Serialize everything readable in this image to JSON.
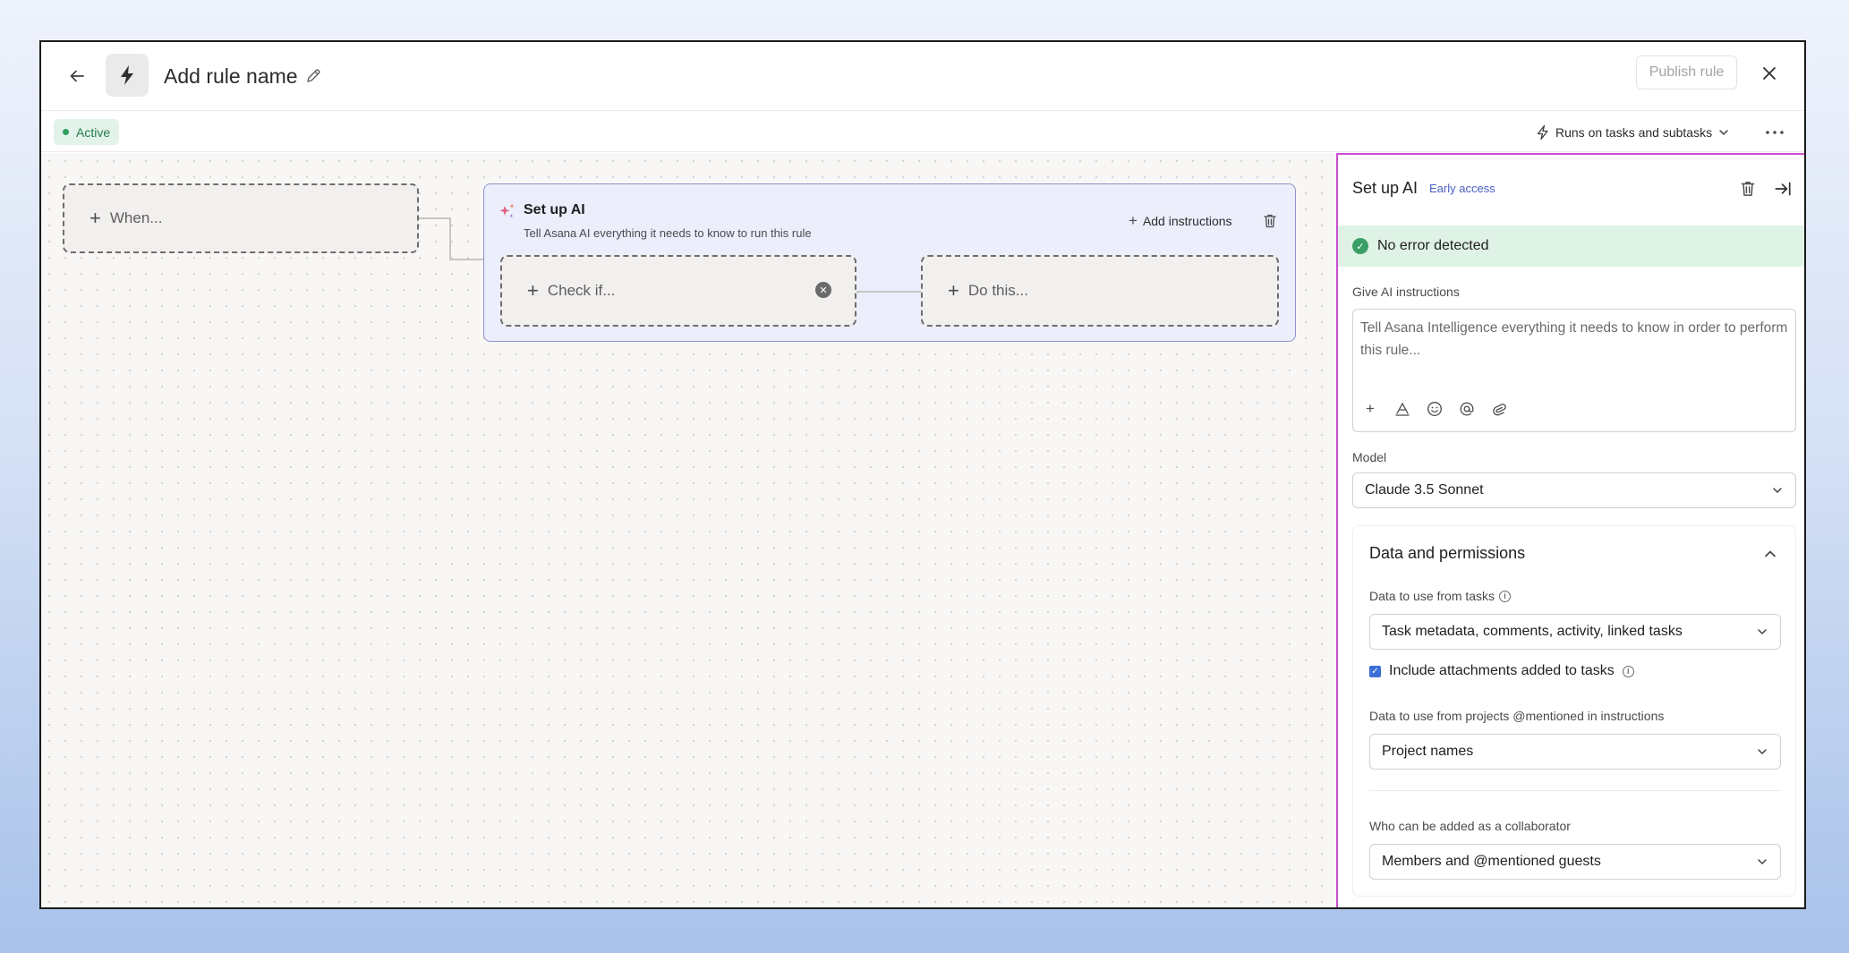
{
  "header": {
    "back_icon": "arrow-left-icon",
    "rule_icon": "lightning-bolt-icon",
    "title": "Add rule name",
    "edit_icon": "pencil-icon",
    "publish_label": "Publish rule",
    "close_icon": "close-icon"
  },
  "subbar": {
    "status": "Active",
    "runs_on": "Runs on tasks and subtasks",
    "more_icon": "ellipsis-icon"
  },
  "canvas": {
    "when_label": "When...",
    "ai_card": {
      "title": "Set up AI",
      "subtitle": "Tell Asana AI everything it needs to know to run this rule",
      "add_instructions": "Add instructions",
      "check_label": "Check if...",
      "do_label": "Do this..."
    }
  },
  "panel": {
    "title": "Set up AI",
    "badge": "Early access",
    "status": "No error detected",
    "instructions_label": "Give AI instructions",
    "instructions_placeholder": "Tell Asana Intelligence everything it needs to know in order to perform this rule...",
    "model_label": "Model",
    "model_value": "Claude 3.5 Sonnet",
    "permissions": {
      "title": "Data and permissions",
      "task_data_label": "Data to use from tasks",
      "task_data_value": "Task metadata, comments, activity, linked tasks",
      "include_attachments_label": "Include attachments added to tasks",
      "include_attachments_checked": true,
      "project_data_label": "Data to use from projects @mentioned in instructions",
      "project_data_value": "Project names",
      "collaborator_label": "Who can be added as a collaborator",
      "collaborator_value": "Members and @mentioned guests"
    }
  },
  "colors": {
    "accent_purple_border": "#c84fd0",
    "active_green": "#2f9e60",
    "ai_card_bg": "#eceefb",
    "success_bg": "#dff2e6",
    "early_access_blue": "#4b5fc4"
  }
}
